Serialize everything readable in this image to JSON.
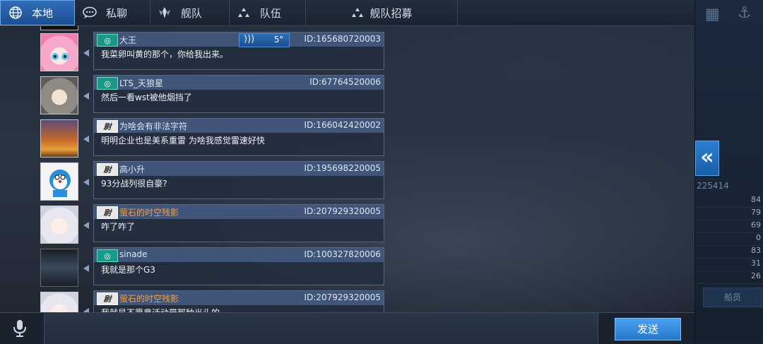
{
  "tabs": [
    {
      "label": "本地",
      "icon": "globe-icon",
      "active": true
    },
    {
      "label": "私聊",
      "icon": "chat-bubble-icon",
      "active": false
    },
    {
      "label": "舰队",
      "icon": "fleet-emblem-icon",
      "active": false
    },
    {
      "label": "队伍",
      "icon": "team-triangle-icon",
      "active": false
    },
    {
      "label": "舰队招募",
      "icon": "recruit-triangle-icon",
      "active": false
    }
  ],
  "messages": [
    {
      "name": "大王",
      "id": "ID:165680720003",
      "text": "我菜卵叫黄的那个，你给我出来。",
      "badge": "green",
      "voice": "5\"",
      "name_orange": false,
      "avatar": "pink-hair-anime-avatar"
    },
    {
      "name": "LTS_天狼星",
      "id": "ID:67764520006",
      "text": "然后一看wst被他烟挡了",
      "badge": "green",
      "name_orange": false,
      "avatar": "grey-hair-anime-avatar"
    },
    {
      "name": "为啥会有非法字符",
      "id": "ID:166042420002",
      "text": "明明企业也是美系重雷 为啥我感觉雷速好快",
      "badge": "white",
      "name_orange": false,
      "avatar": "wolf-girl-avatar"
    },
    {
      "name": "高小升",
      "id": "ID:195698220005",
      "text": "93分战列很自豪?",
      "badge": "white",
      "name_orange": false,
      "avatar": "blue-cartoon-avatar"
    },
    {
      "name": "萤石的时空残影",
      "id": "ID:207929320005",
      "text": "咋了咋了",
      "badge": "white",
      "name_orange": true,
      "avatar": "white-hair-anime-avatar"
    },
    {
      "name": "sinade",
      "id": "ID:100327820006",
      "text": "我就是那个G3",
      "badge": "green",
      "name_orange": false,
      "avatar": "dark-screenshot-avatar"
    },
    {
      "name": "萤石的时空残影",
      "id": "ID:207929320005",
      "text": "我就是不愿意活动带那种光头的",
      "badge": "white",
      "name_orange": true,
      "avatar": "white-hair-anime-avatar"
    }
  ],
  "input": {
    "placeholder": "",
    "send_label": "发送"
  },
  "right_panel": {
    "number": "225414",
    "stats": [
      "84",
      "79",
      "69",
      "0",
      "83",
      "31",
      "26"
    ],
    "button_label": "船员"
  }
}
